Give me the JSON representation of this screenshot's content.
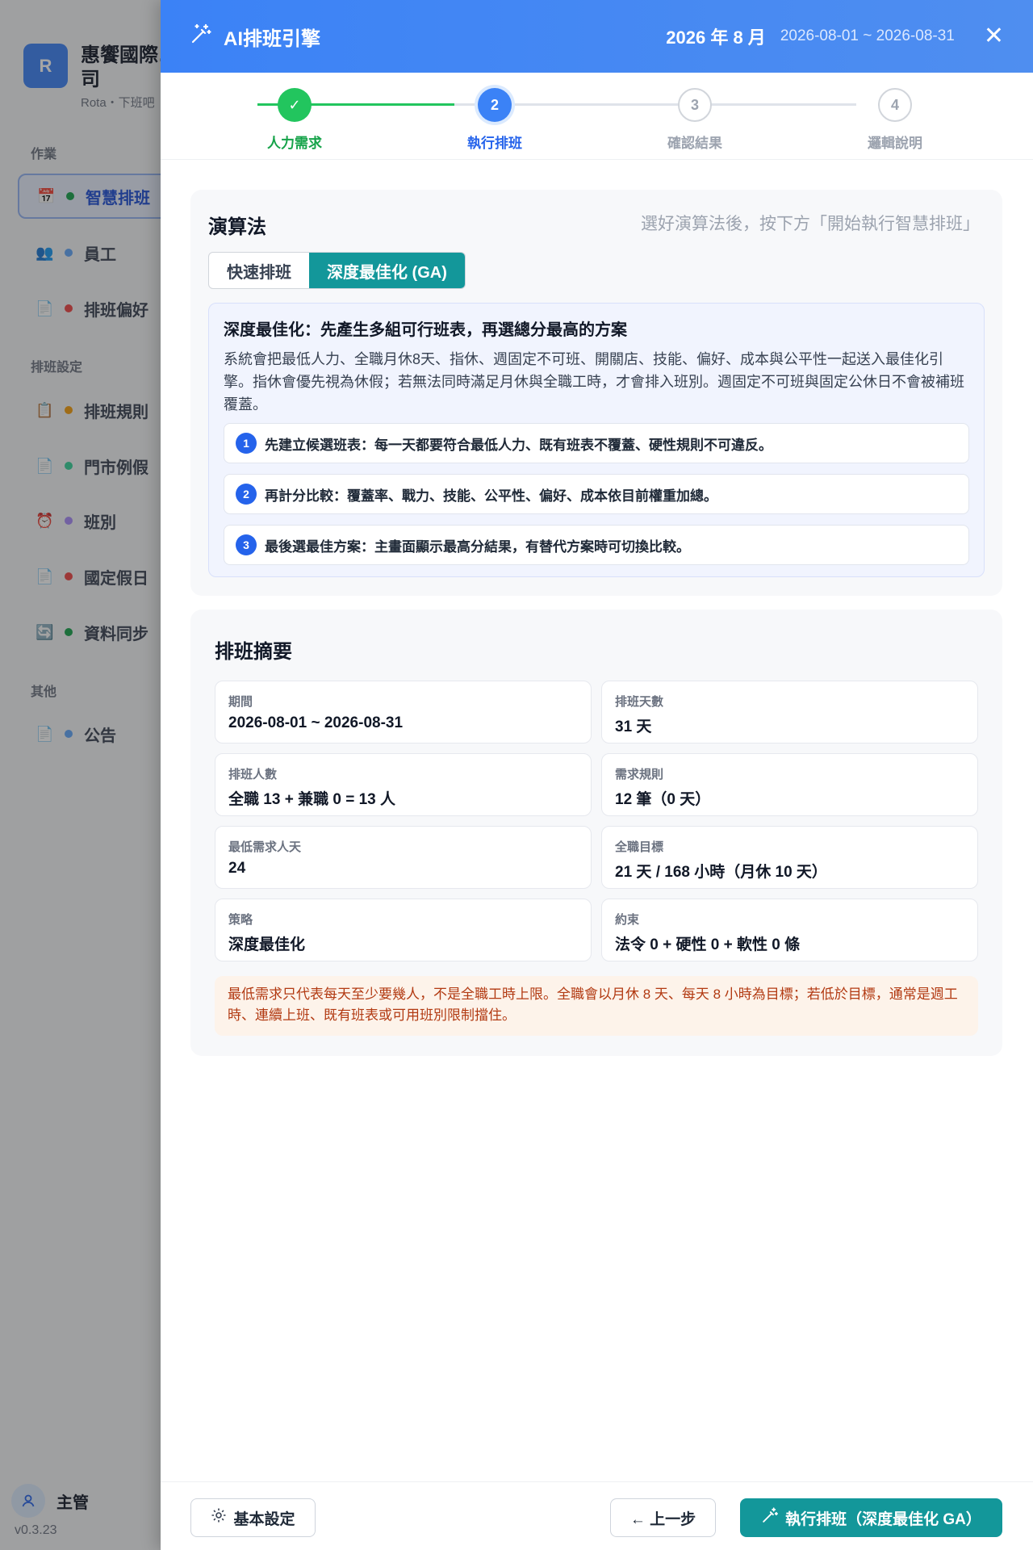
{
  "sidebar": {
    "logo_letter": "R",
    "company_name": "惠饗國際…",
    "company_name_line2": "司",
    "subtitle": "Rota・下班吧",
    "sections": {
      "work": "作業",
      "settings": "排班設定",
      "other": "其他"
    },
    "items": [
      {
        "label": "智慧排班",
        "icon": "📅",
        "dot": "#16a34a"
      },
      {
        "label": "員工",
        "icon": "👥",
        "dot": "#60a5fa"
      },
      {
        "label": "排班偏好",
        "icon": "📄",
        "dot": "#ef4444"
      },
      {
        "label": "排班規則",
        "icon": "📋",
        "dot": "#f59e0b"
      },
      {
        "label": "門市例假",
        "icon": "📄",
        "dot": "#34d399"
      },
      {
        "label": "班別",
        "icon": "⏰",
        "dot": "#a78bfa"
      },
      {
        "label": "國定假日",
        "icon": "📄",
        "dot": "#ef4444"
      },
      {
        "label": "資料同步",
        "icon": "🔄",
        "dot": "#16a34a"
      },
      {
        "label": "公告",
        "icon": "📄",
        "dot": "#60a5fa"
      }
    ],
    "user": "主管",
    "version": "v0.3.23"
  },
  "header": {
    "icon": "magic-wand-icon",
    "title": "AI排班引擎",
    "period": "2026 年 8 月",
    "range": "2026-08-01 ~ 2026-08-31",
    "close": "✕"
  },
  "steps": [
    {
      "num": "✓",
      "label": "人力需求",
      "state": "done"
    },
    {
      "num": "2",
      "label": "執行排班",
      "state": "active"
    },
    {
      "num": "3",
      "label": "確認結果",
      "state": "pending"
    },
    {
      "num": "4",
      "label": "邏輯說明",
      "state": "pending"
    }
  ],
  "algorithm": {
    "title": "演算法",
    "hint": "選好演算法後，按下方「開始執行智慧排班」",
    "options": [
      "快速排班",
      "深度最佳化 (GA)"
    ],
    "selected": "深度最佳化 (GA)",
    "detail_title": "深度最佳化：先產生多組可行班表，再選總分最高的方案",
    "detail_desc": "系統會把最低人力、全職月休8天、指休、週固定不可班、開關店、技能、偏好、成本與公平性一起送入最佳化引擎。指休會優先視為休假；若無法同時滿足月休與全職工時，才會排入班別。週固定不可班與固定公休日不會被補班覆蓋。",
    "steps": [
      "先建立候選班表：每一天都要符合最低人力、既有班表不覆蓋、硬性規則不可違反。",
      "再計分比較：覆蓋率、戰力、技能、公平性、偏好、成本依目前權重加總。",
      "最後選最佳方案：主畫面顯示最高分結果，有替代方案時可切換比較。"
    ]
  },
  "summary": {
    "title": "排班摘要",
    "items": [
      {
        "label": "期間",
        "value": "2026-08-01 ~ 2026-08-31"
      },
      {
        "label": "排班天數",
        "value": "31 天"
      },
      {
        "label": "排班人數",
        "value": "全職 13 + 兼職 0 = 13 人"
      },
      {
        "label": "需求規則",
        "value": "12 筆（0 天）"
      },
      {
        "label": "最低需求人天",
        "value": "24"
      },
      {
        "label": "全職目標",
        "value": "21 天 / 168 小時（月休 10 天）"
      },
      {
        "label": "策略",
        "value": "深度最佳化"
      },
      {
        "label": "約束",
        "value": "法令 0 + 硬性 0 + 軟性 0 條"
      }
    ],
    "note": "最低需求只代表每天至少要幾人，不是全職工時上限。全職會以月休 8 天、每天 8 小時為目標；若低於目標，通常是週工時、連續上班、既有班表或可用班別限制擋住。"
  },
  "footer": {
    "settings_label": "基本設定",
    "back_label": "← 上一步",
    "run_label": "執行排班（深度最佳化 GA）"
  },
  "colors": {
    "primary": "#3b82f6",
    "teal": "#13979a",
    "done": "#22c55e"
  }
}
